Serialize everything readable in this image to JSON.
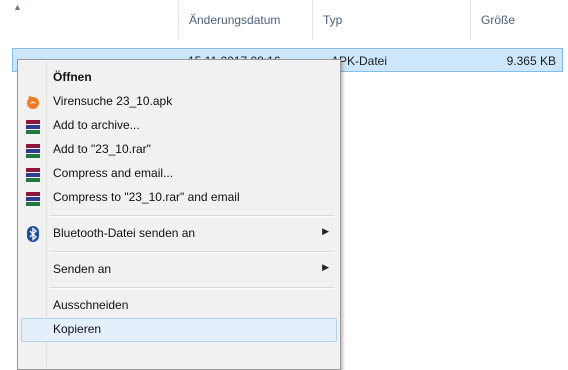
{
  "header": {
    "columns": [
      "Änderungsdatum",
      "Typ",
      "Größe"
    ]
  },
  "file_row": {
    "date": "15.11.2017 08:16",
    "type": "APK-Datei",
    "size": "9.365 KB"
  },
  "context_menu": {
    "items": [
      {
        "label": "Öffnen",
        "icon": "none"
      },
      {
        "label": "Virensuche 23_10.apk",
        "icon": "avast-icon"
      },
      {
        "label": "Add to archive...",
        "icon": "winrar-icon"
      },
      {
        "label": "Add to \"23_10.rar\"",
        "icon": "winrar-icon"
      },
      {
        "label": "Compress and email...",
        "icon": "winrar-icon"
      },
      {
        "label": "Compress to \"23_10.rar\" and email",
        "icon": "winrar-icon"
      },
      {
        "label": "Bluetooth-Datei senden an",
        "icon": "bluetooth-icon",
        "submenu": true
      },
      {
        "label": "Senden an",
        "icon": "none",
        "submenu": true
      },
      {
        "label": "Ausschneiden",
        "icon": "none"
      },
      {
        "label": "Kopieren",
        "icon": "none",
        "highlighted": true
      }
    ]
  },
  "colors": {
    "selection_fill": "#cce6fb",
    "selection_border": "#84bdec",
    "menu_background": "#f1f1f1",
    "hover_fill": "#e3effb"
  }
}
